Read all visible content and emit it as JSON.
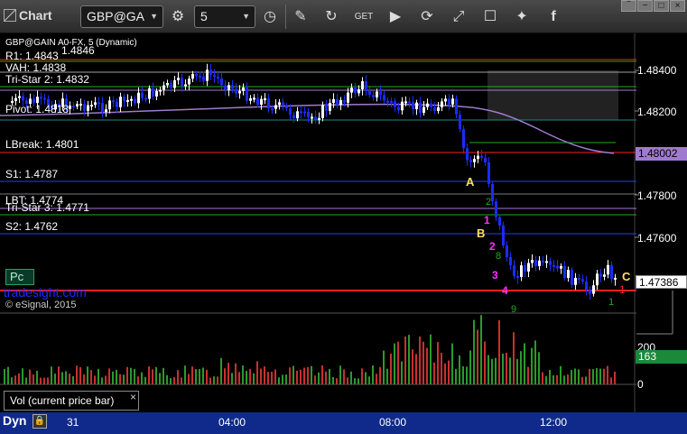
{
  "toolbar": {
    "title": "Chart",
    "symbol": "GBP@GA",
    "interval": "5",
    "icons": [
      "gear-icon",
      "clock-icon",
      "pencil-icon",
      "refresh-icon",
      "get-icon",
      "play-icon",
      "rotate-icon",
      "check-icon",
      "chat-icon",
      "twitter-icon",
      "facebook-icon"
    ]
  },
  "header": {
    "symbol_line": "GBP@GAIN A0-FX, 5 (Dynamic)",
    "r1_value": "1.4846"
  },
  "levels": {
    "r1": "R1: 1.4843",
    "vah": "VAH: 1.4838",
    "tristar2": "Tri-Star 2: 1.4832",
    "pivot": "Pivot: 1.4818",
    "lbreak": "LBreak: 1.4801",
    "s1": "S1: 1.4787",
    "lbt": "LBT: 1.4774",
    "tristar3": "Tri-Star 3: 1.4771",
    "s2": "S2: 1.4762"
  },
  "price_axis": [
    "1.48400",
    "1.48200",
    "1.47800",
    "1.47600"
  ],
  "price_tags": {
    "ma": "1.48002",
    "last": "1.47386",
    "volume_last": "163"
  },
  "volume_axis": [
    "200",
    "0"
  ],
  "annotations": {
    "a": "A",
    "b": "B",
    "c": "C",
    "n1": "1",
    "n2": "2",
    "n3": "3",
    "n4": "4",
    "g2": "2",
    "g1": "1",
    "g9": "9",
    "g8": "8",
    "g1b": "1"
  },
  "watermark": {
    "pc": "Pc",
    "brand": "tradesight.com",
    "copyright": "© eSignal, 2015"
  },
  "volume_study": "Vol (current price bar)",
  "time_axis": {
    "dyn": "Dyn",
    "day": "31",
    "t1": "04:00",
    "t2": "08:00",
    "t3": "12:00"
  },
  "colors": {
    "up": "#ffffff",
    "down": "#1a2cff",
    "ma": "#a07ad0",
    "red": "#ff2020",
    "green": "#22aa22",
    "blue": "#2a3aff",
    "label_yellow": "#ffe060",
    "label_magenta": "#ff30ff",
    "bottom_bar": "#0f2a8a"
  }
}
